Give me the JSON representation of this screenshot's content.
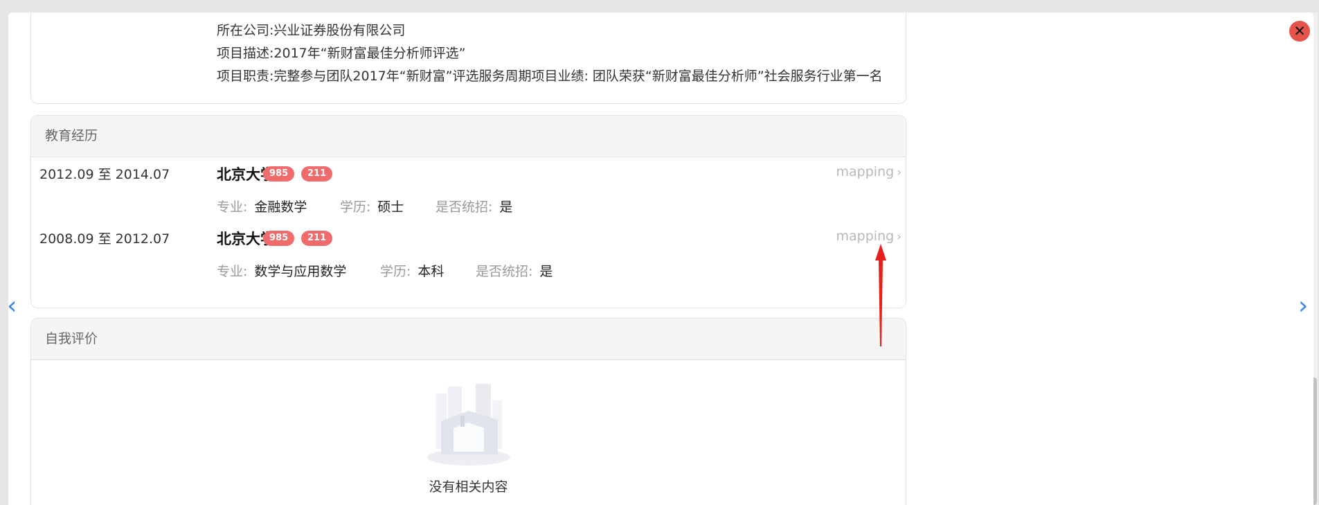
{
  "project": {
    "company_label": "所在公司:",
    "company": "兴业证券股份有限公司",
    "desc_label": "项目描述:",
    "desc": "2017年“新财富最佳分析师评选”",
    "duty_label": "项目职责:",
    "duty": "完整参与团队2017年“新财富”评选服务周期项目业绩: 团队荣获“新财富最佳分析师”社会服务行业第一名"
  },
  "education": {
    "title": "教育经历",
    "items": [
      {
        "date": "2012.09 至 2014.07",
        "school": "北京大学",
        "badges": [
          "985",
          "211"
        ],
        "link": "mapping",
        "major_label": "专业:",
        "major": "金融数学",
        "degree_label": "学历:",
        "degree": "硕士",
        "unified_label": "是否统招:",
        "unified": "是"
      },
      {
        "date": "2008.09 至 2012.07",
        "school": "北京大学",
        "badges": [
          "985",
          "211"
        ],
        "link": "mapping",
        "major_label": "专业:",
        "major": "数学与应用数学",
        "degree_label": "学历:",
        "degree": "本科",
        "unified_label": "是否统招:",
        "unified": "是"
      }
    ]
  },
  "self_eval": {
    "title": "自我评价",
    "empty_text": "没有相关内容"
  },
  "icons": {
    "close": "close-icon",
    "prev": "chevron-left-icon",
    "next": "chevron-right-icon",
    "empty": "empty-illustration"
  },
  "colors": {
    "badge": "#f06b6b",
    "arrow_annotation": "#e8201a",
    "nav_arrow": "#3a84e8",
    "close_button": "#e5534b"
  }
}
